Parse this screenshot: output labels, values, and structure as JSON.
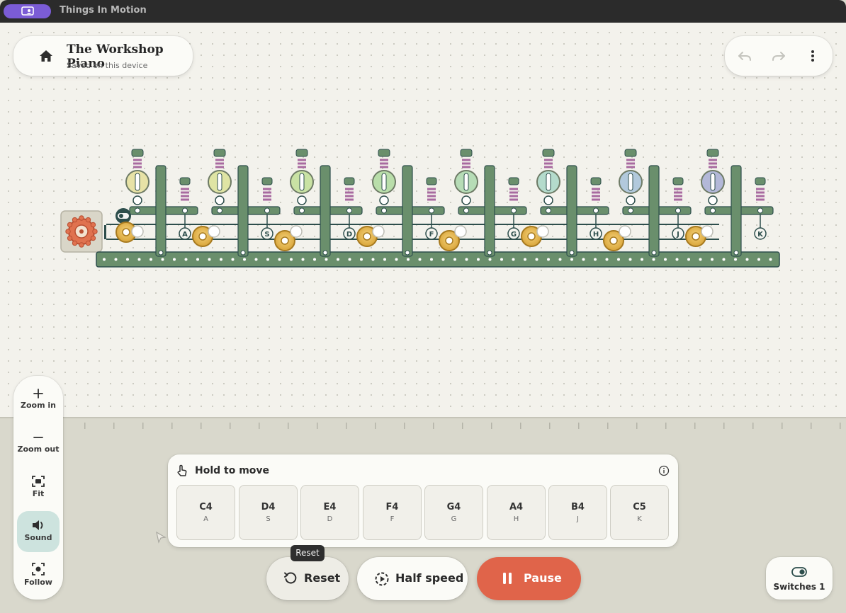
{
  "app": {
    "title": "Things In Motion"
  },
  "document": {
    "title": "The Workshop Piano",
    "subtitle": "Saved on this device"
  },
  "zoom_panel": {
    "zoom_in": "Zoom in",
    "zoom_out": "Zoom out",
    "fit": "Fit",
    "sound": "Sound",
    "follow": "Follow"
  },
  "keyboard": {
    "title": "Hold to move",
    "keys": [
      {
        "note": "C4",
        "key": "A"
      },
      {
        "note": "D4",
        "key": "S"
      },
      {
        "note": "E4",
        "key": "D"
      },
      {
        "note": "F4",
        "key": "F"
      },
      {
        "note": "G4",
        "key": "G"
      },
      {
        "note": "A4",
        "key": "H"
      },
      {
        "note": "B4",
        "key": "J"
      },
      {
        "note": "C5",
        "key": "K"
      }
    ]
  },
  "machine": {
    "labels": [
      "A",
      "S",
      "D",
      "F",
      "G",
      "H",
      "J",
      "K"
    ]
  },
  "controls": {
    "tooltip": "Reset",
    "reset": "Reset",
    "half_speed": "Half speed",
    "pause": "Pause"
  },
  "switches": {
    "label": "Switches 1"
  },
  "colors": {
    "accent": "#7b5cd6",
    "pause": "#e0644a",
    "frame_green": "#6a8f6c",
    "sound_active": "#cde3de",
    "spring": "#a86aa0",
    "cam": "#dcac3c"
  }
}
